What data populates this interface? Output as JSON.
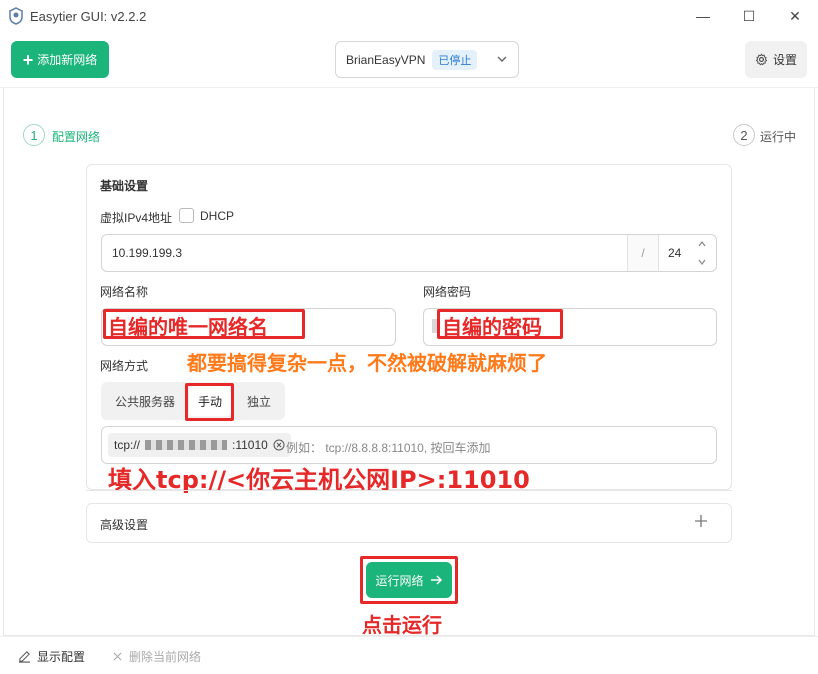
{
  "window": {
    "title": "Easytier GUI: v2.2.2",
    "controls": {
      "minimize": "—",
      "maximize": "☐",
      "close": "✕"
    }
  },
  "toolbar": {
    "add_network_label": "添加新网络",
    "selected_network": "BrianEasyVPN",
    "network_status": "已停止",
    "settings_label": "设置"
  },
  "steps": [
    {
      "number": "1",
      "label": "配置网络"
    },
    {
      "number": "2",
      "label": "运行中"
    }
  ],
  "basic": {
    "title": "基础设置",
    "ipv4_label": "虚拟IPv4地址",
    "dhcp_label": "DHCP",
    "ipv4_value": "10.199.199.3",
    "slash": "/",
    "prefix_value": "24",
    "network_name_label": "网络名称",
    "network_password_label": "网络密码",
    "network_mode_label": "网络方式",
    "modes": [
      "公共服务器",
      "手动",
      "独立"
    ],
    "selected_mode": "手动",
    "peer_tag_prefix": "tcp://",
    "peer_tag_suffix": ":11010",
    "peer_placeholder": "例如： tcp://8.8.8.8:11010, 按回车添加"
  },
  "advanced": {
    "title": "高级设置"
  },
  "run_button_label": "运行网络",
  "footer": {
    "show_config_label": "显示配置",
    "delete_network_label": "删除当前网络"
  },
  "annotations": {
    "network_name": "自编的唯一网络名",
    "network_password": "自编的密码",
    "complexity_note": "都要搞得复杂一点，不然被破解就麻烦了",
    "peer_note": "填入tcp://<你云主机公网IP>:11010",
    "run_note": "点击运行"
  },
  "colors": {
    "accent": "#1bb47a",
    "annotation_red": "#e62828",
    "annotation_orange": "#ff7a1a",
    "status_badge": "#2b7bd3"
  }
}
